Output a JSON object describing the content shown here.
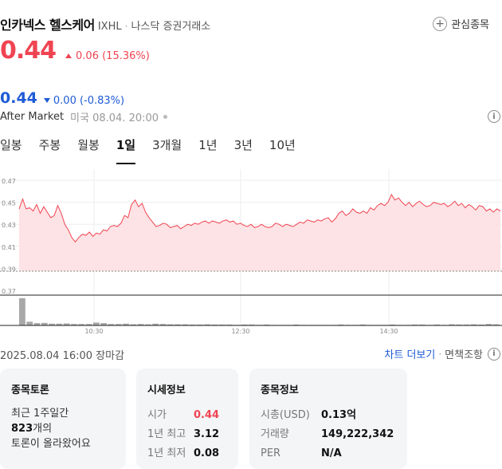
{
  "header": {
    "name": "인카넥스 헬스케어",
    "ticker": "IXHL",
    "separator": "·",
    "exchange": "나스닥 증권거래소",
    "watch_label": "관심종목",
    "watch_icon": "plus-icon"
  },
  "price": {
    "value": "0.44",
    "change": "0.06 (15.36%)",
    "direction": "up",
    "color": "#f04452"
  },
  "after_market": {
    "price": "0.44",
    "change": "0.00 (-0.83%)",
    "direction": "down",
    "color": "#1e5bd6",
    "label": "After Market",
    "time": "미국 08.04. 20:00"
  },
  "tabs": [
    {
      "label": "일봉",
      "active": false
    },
    {
      "label": "주봉",
      "active": false
    },
    {
      "label": "월봉",
      "active": false
    },
    {
      "label": "1일",
      "active": true
    },
    {
      "label": "3개월",
      "active": false
    },
    {
      "label": "1년",
      "active": false
    },
    {
      "label": "3년",
      "active": false
    },
    {
      "label": "10년",
      "active": false
    }
  ],
  "chart_data": {
    "type": "area",
    "y_ticks": [
      "0.47",
      "0.45",
      "0.43",
      "0.41",
      "0.39",
      "0.37"
    ],
    "ylim": [
      0.37,
      0.47
    ],
    "x_ticks": [
      "10:30",
      "12:30",
      "14:30"
    ],
    "baseline": 0.3874,
    "color": "#f04452",
    "series": [
      {
        "values": [
          0.444,
          0.453,
          0.444,
          0.445,
          0.442,
          0.448,
          0.44,
          0.446,
          0.441,
          0.436,
          0.438,
          0.447,
          0.44,
          0.43,
          0.425,
          0.418,
          0.414,
          0.418,
          0.421,
          0.42,
          0.423,
          0.419,
          0.422,
          0.421,
          0.425,
          0.424,
          0.428,
          0.429,
          0.428,
          0.431,
          0.438,
          0.436,
          0.448,
          0.452,
          0.446,
          0.449,
          0.441,
          0.436,
          0.432,
          0.428,
          0.429,
          0.431,
          0.43,
          0.427,
          0.428,
          0.429,
          0.426,
          0.428,
          0.43,
          0.429,
          0.431,
          0.43,
          0.432,
          0.433,
          0.431,
          0.433,
          0.432,
          0.431,
          0.433,
          0.434,
          0.432,
          0.433,
          0.43,
          0.431,
          0.429,
          0.428,
          0.43,
          0.427,
          0.428,
          0.43,
          0.428,
          0.427,
          0.428,
          0.431,
          0.43,
          0.428,
          0.43,
          0.429,
          0.428,
          0.43,
          0.432,
          0.431,
          0.434,
          0.433,
          0.432,
          0.434,
          0.433,
          0.435,
          0.436,
          0.432,
          0.435,
          0.44,
          0.442,
          0.438,
          0.44,
          0.444,
          0.441,
          0.44,
          0.442,
          0.44,
          0.445,
          0.443,
          0.447,
          0.449,
          0.447,
          0.45,
          0.457,
          0.452,
          0.454,
          0.45,
          0.447,
          0.45,
          0.446,
          0.449,
          0.451,
          0.448,
          0.446,
          0.447,
          0.45,
          0.449,
          0.448,
          0.449,
          0.446,
          0.448,
          0.451,
          0.447,
          0.449,
          0.445,
          0.448,
          0.446,
          0.443,
          0.447,
          0.446,
          0.442,
          0.444,
          0.441,
          0.444,
          0.442
        ]
      }
    ],
    "volume": [
      0.95,
      0.13,
      0.08,
      0.09,
      0.06,
      0.06,
      0.07,
      0.05,
      0.05,
      0.05,
      0.1,
      0.08,
      0.05,
      0.05,
      0.06,
      0.04,
      0.05,
      0.04,
      0.06,
      0.05,
      0.04,
      0.04,
      0.04,
      0.03,
      0.03,
      0.04,
      0.03,
      0.03,
      0.03,
      0.02,
      0.03,
      0.03,
      0.02,
      0.03,
      0.02,
      0.02,
      0.02,
      0.03,
      0.02,
      0.02,
      0.02,
      0.02,
      0.02,
      0.03,
      0.02,
      0.02,
      0.03,
      0.02,
      0.02,
      0.02,
      0.03,
      0.02,
      0.02,
      0.03,
      0.03,
      0.02,
      0.03,
      0.02,
      0.04,
      0.03,
      0.03,
      0.04,
      0.03,
      0.05,
      0.04
    ]
  },
  "footer": {
    "date": "2025.08.04 16:00 장마감",
    "chart_more": "차트 더보기",
    "separator": "·",
    "disclaimer": "면책조항"
  },
  "cards": {
    "discussion": {
      "title": "종목토론",
      "line1": "최근 1주일간",
      "count": "823",
      "count_suffix": "개의",
      "line3": "토론이 올라왔어요"
    },
    "market": {
      "title": "시세정보",
      "rows": [
        {
          "label": "시가",
          "value": "0.44"
        },
        {
          "label": "1년 최고",
          "value": "3.12"
        },
        {
          "label": "1년 최저",
          "value": "0.08"
        }
      ]
    },
    "stock_info": {
      "title": "종목정보",
      "rows": [
        {
          "label": "시총(USD)",
          "value": "0.13억"
        },
        {
          "label": "거래량",
          "value": "149,222,342"
        },
        {
          "label": "PER",
          "value": "N/A"
        }
      ]
    }
  }
}
